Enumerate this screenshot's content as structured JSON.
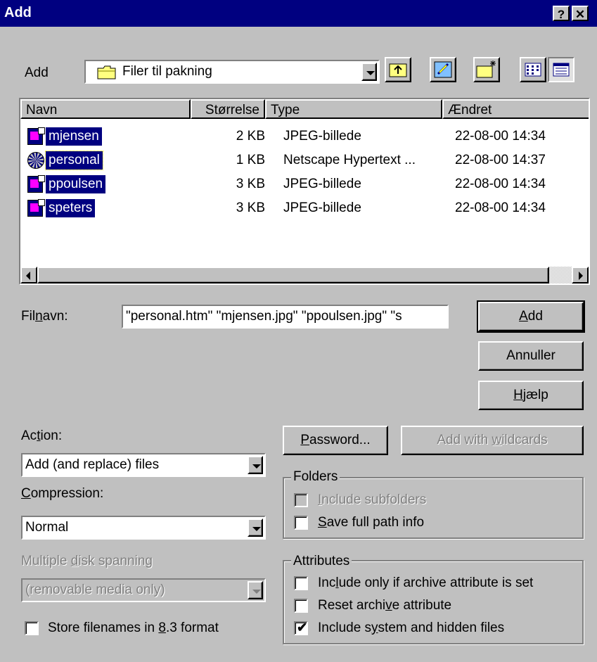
{
  "window": {
    "title": "Add",
    "help_glyph": "?",
    "close_glyph": "✕"
  },
  "location": {
    "label": "Add",
    "folder": "Filer til pakning",
    "folder_icon": "folder-icon"
  },
  "toolbar": {
    "icons": [
      "up-folder-icon",
      "desktop-icon",
      "new-folder-icon",
      "list-view-icon",
      "details-view-icon"
    ]
  },
  "list": {
    "columns": [
      "Navn",
      "Størrelse",
      "Type",
      "Ændret"
    ],
    "rows": [
      {
        "name": "mjensen",
        "size": "2 KB",
        "type": "JPEG-billede",
        "modified": "22-08-00 14:34",
        "icon": "jpeg-file-icon"
      },
      {
        "name": "personal",
        "size": "1 KB",
        "type": "Netscape Hypertext ...",
        "modified": "22-08-00 14:37",
        "icon": "html-file-icon"
      },
      {
        "name": "ppoulsen",
        "size": "3 KB",
        "type": "JPEG-billede",
        "modified": "22-08-00 14:34",
        "icon": "jpeg-file-icon"
      },
      {
        "name": "speters",
        "size": "3 KB",
        "type": "JPEG-billede",
        "modified": "22-08-00 14:34",
        "icon": "jpeg-file-icon"
      }
    ]
  },
  "filename": {
    "label_pre": "Fil",
    "label_ul": "n",
    "label_post": "avn:",
    "value": "\"personal.htm\" \"mjensen.jpg\" \"ppoulsen.jpg\" \"s"
  },
  "buttons": {
    "add_ul": "A",
    "add_rest": "dd",
    "cancel": "Annuller",
    "help_ul": "H",
    "help_rest": "jælp",
    "password_ul": "P",
    "password_rest": "assword...",
    "wildcards_pre": "Add with ",
    "wildcards_ul": "w",
    "wildcards_post": "ildcards"
  },
  "action": {
    "label_pre": "Ac",
    "label_ul": "t",
    "label_post": "ion:",
    "value": "Add (and replace) files"
  },
  "compression": {
    "label_ul": "C",
    "label_post": "ompression:",
    "value": "Normal"
  },
  "spanning": {
    "label_pre": "Multiple ",
    "label_ul": "d",
    "label_post": "isk spanning",
    "value": "(removable media only)"
  },
  "store83": {
    "label_pre": "Store filenames in ",
    "label_ul": "8",
    "label_post": ".3 format",
    "checked": false
  },
  "folders": {
    "title": "Folders",
    "include_sub": {
      "label_ul": "I",
      "label_post": "nclude subfolders",
      "checked": false,
      "enabled": false
    },
    "save_path": {
      "label_ul": "S",
      "label_post": "ave full path info",
      "checked": false
    }
  },
  "attributes": {
    "title": "Attributes",
    "archive_only": {
      "label_pre": "Inc",
      "label_ul": "l",
      "label_post": "ude only if archive attribute is set",
      "checked": false
    },
    "reset_archive": {
      "label_pre": "Reset archi",
      "label_ul": "v",
      "label_post": "e attribute",
      "checked": false
    },
    "system_hidden": {
      "label_pre": "Include s",
      "label_ul": "y",
      "label_post": "stem and hidden files",
      "checked": true,
      "mark": "✔"
    }
  }
}
